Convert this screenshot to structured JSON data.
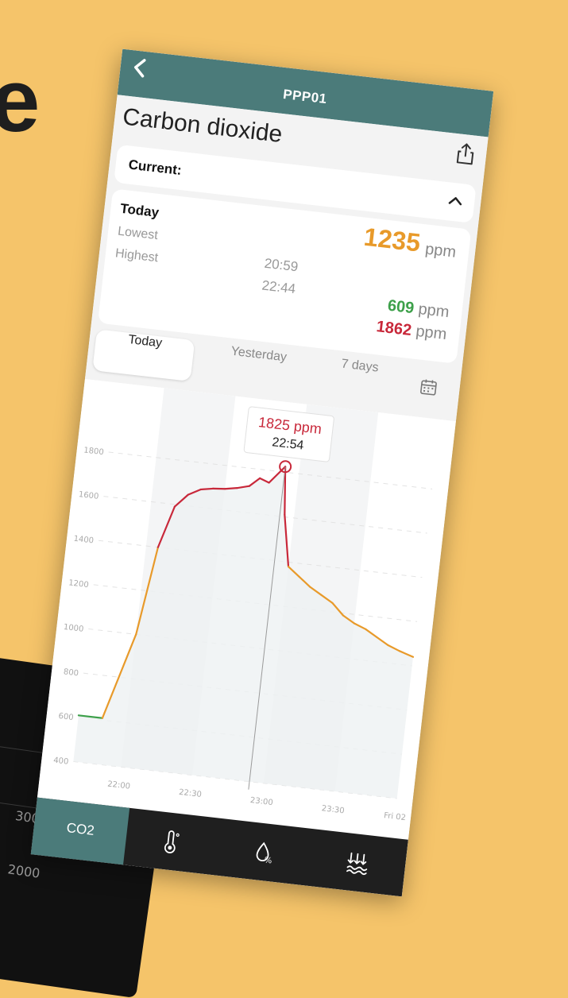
{
  "header": {
    "title": "PPP01"
  },
  "page": {
    "title": "Carbon dioxide"
  },
  "current": {
    "label": "Current:",
    "value": "1235",
    "unit": "ppm"
  },
  "today": {
    "label": "Today",
    "lowest_label": "Lowest",
    "highest_label": "Highest",
    "lowest_time": "20:59",
    "highest_time": "22:44",
    "lowest_value": "609",
    "highest_value": "1862",
    "unit": "ppm"
  },
  "tabs": [
    {
      "label": "Today",
      "active": true
    },
    {
      "label": "Yesterday",
      "active": false
    },
    {
      "label": "7 days",
      "active": false
    }
  ],
  "tooltip": {
    "value": "1825 ppm",
    "time": "22:54"
  },
  "bottom_tabs": [
    {
      "label": "CO2",
      "icon": "co2-icon",
      "active": true
    },
    {
      "icon": "thermometer-icon",
      "active": false
    },
    {
      "icon": "humidity-icon",
      "active": false
    },
    {
      "icon": "pressure-icon",
      "active": false
    }
  ],
  "background_device": {
    "labels": [
      "3000",
      "2000"
    ]
  },
  "colors": {
    "accent": "#4b7b7a",
    "orange": "#e89a2a",
    "green": "#3da04a",
    "red": "#c8283a",
    "background": "#f5c46a"
  },
  "chart_data": {
    "type": "line",
    "title": "",
    "xlabel": "",
    "ylabel": "",
    "xlim": [
      "21:40",
      "23:56"
    ],
    "ylim": [
      400,
      1900
    ],
    "x_ticks": [
      "22:00",
      "22:30",
      "23:00",
      "23:30",
      "Fri 02"
    ],
    "y_ticks": [
      400,
      600,
      800,
      1000,
      1200,
      1400,
      1600,
      1800
    ],
    "grid": true,
    "series": [
      {
        "x": [
          "21:40",
          "21:50",
          "22:00",
          "22:05",
          "22:10",
          "22:15",
          "22:20",
          "22:25",
          "22:30",
          "22:35",
          "22:40",
          "22:44",
          "22:48",
          "22:54",
          "22:56",
          "23:00",
          "23:05",
          "23:10",
          "23:15",
          "23:20",
          "23:25",
          "23:30",
          "23:35",
          "23:40",
          "23:45",
          "23:50",
          "23:56"
        ],
        "values": [
          609,
          609,
          1000,
          1400,
          1590,
          1650,
          1680,
          1690,
          1695,
          1705,
          1720,
          1760,
          1745,
          1825,
          1610,
          1380,
          1340,
          1300,
          1270,
          1240,
          1190,
          1160,
          1140,
          1110,
          1080,
          1060,
          1040
        ]
      }
    ]
  }
}
